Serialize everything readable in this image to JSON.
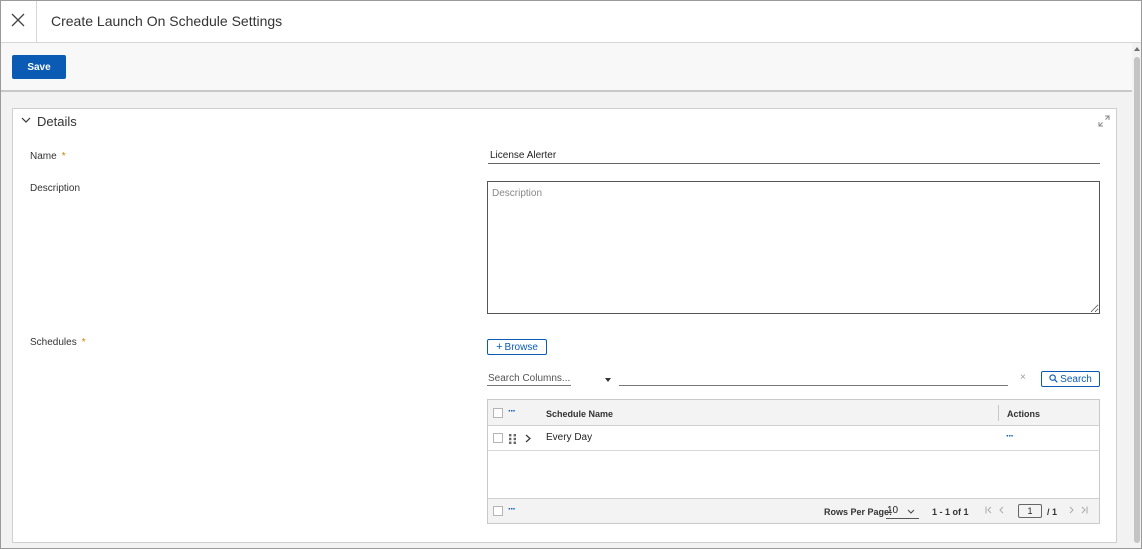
{
  "window": {
    "title": "Create Launch On Schedule Settings"
  },
  "toolbar": {
    "save_label": "Save"
  },
  "details": {
    "section_title": "Details",
    "name_label": "Name",
    "name_value": "License Alerter",
    "description_label": "Description",
    "description_placeholder": "Description",
    "schedules_label": "Schedules",
    "required_mark": "*"
  },
  "schedules": {
    "browse_label": "Browse",
    "search_columns_placeholder": "Search Columns...",
    "clear_label": "×",
    "search_label": "Search",
    "columns": [
      "Schedule Name",
      "Actions"
    ],
    "rows": [
      {
        "schedule_name": "Every Day",
        "actions": "···"
      }
    ],
    "footer": {
      "rows_per_page_label": "Rows Per Page:",
      "rows_per_page_value": "10",
      "range_text": "1 - 1 of 1",
      "current_page": "1",
      "total_pages": "/ 1"
    }
  },
  "colors": {
    "accent": "#0b5bb5",
    "required": "#e07b00"
  }
}
